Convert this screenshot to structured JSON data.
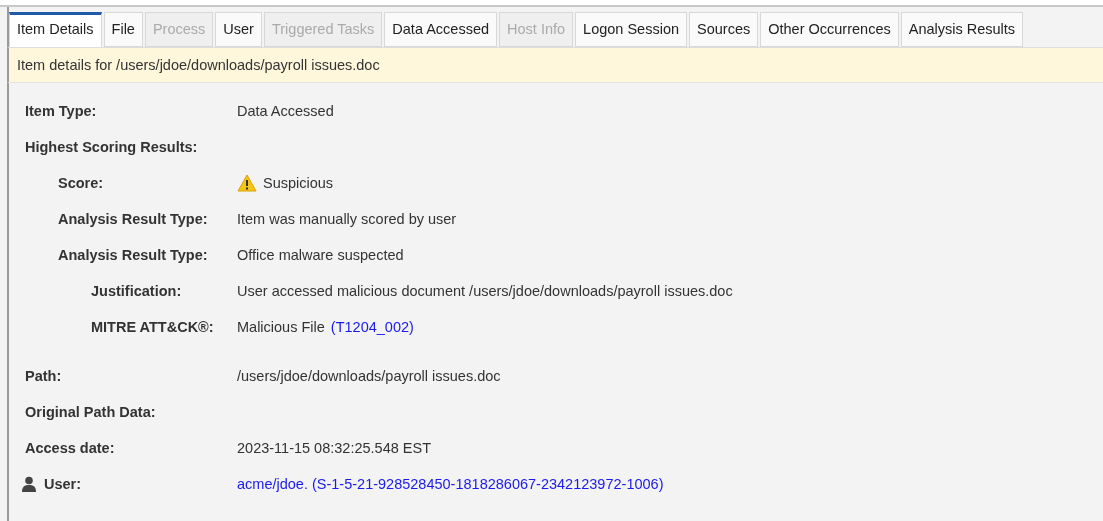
{
  "tabs": [
    {
      "label": "Item Details",
      "selected": true,
      "disabled": false
    },
    {
      "label": "File",
      "selected": false,
      "disabled": false
    },
    {
      "label": "Process",
      "selected": false,
      "disabled": true
    },
    {
      "label": "User",
      "selected": false,
      "disabled": false
    },
    {
      "label": "Triggered Tasks",
      "selected": false,
      "disabled": true
    },
    {
      "label": "Data Accessed",
      "selected": false,
      "disabled": false
    },
    {
      "label": "Host Info",
      "selected": false,
      "disabled": true
    },
    {
      "label": "Logon Session",
      "selected": false,
      "disabled": false
    },
    {
      "label": "Sources",
      "selected": false,
      "disabled": false
    },
    {
      "label": "Other Occurrences",
      "selected": false,
      "disabled": false
    },
    {
      "label": "Analysis Results",
      "selected": false,
      "disabled": false
    }
  ],
  "banner": "Item details for /users/jdoe/downloads/payroll issues.doc",
  "details": [
    {
      "label": "Item Type:",
      "value": "Data Accessed"
    },
    {
      "label": "Highest Scoring Results:",
      "children": [
        {
          "label": "Score:",
          "value": "Suspicious",
          "kind": "score"
        },
        {
          "label": "Analysis Result Type:",
          "value": "Item was manually scored by user"
        },
        {
          "label": "Analysis Result Type:",
          "value": "Office malware suspected",
          "children": [
            {
              "label": "Justification:",
              "value": "User accessed malicious document /users/jdoe/downloads/payroll issues.doc"
            },
            {
              "label": "MITRE ATT&CK®:",
              "value": "Malicious File",
              "link": "(T1204_002)"
            }
          ]
        }
      ]
    },
    {
      "label": "Path:",
      "value": "/users/jdoe/downloads/payroll issues.doc"
    },
    {
      "label": "Original Path Data:"
    },
    {
      "label": "Access date:",
      "value": "2023-11-15 08:32:25.548 EST"
    },
    {
      "label": "User:",
      "kind": "user",
      "link": "acme/jdoe. (S-1-5-21-928528450-1818286067-2342123972-1006)"
    }
  ]
}
